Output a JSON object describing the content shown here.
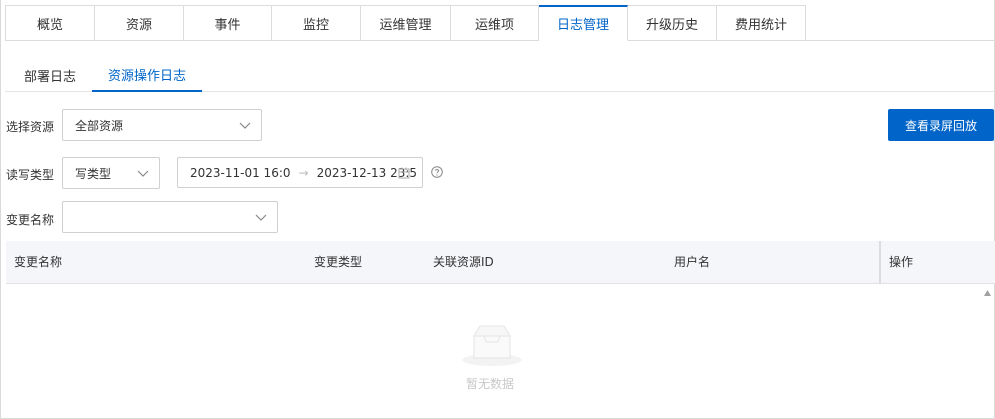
{
  "top_tabs": [
    "概览",
    "资源",
    "事件",
    "监控",
    "运维管理",
    "运维项",
    "日志管理",
    "升级历史",
    "费用统计"
  ],
  "top_tab_active": "日志管理",
  "sub_tabs": [
    "部署日志",
    "资源操作日志"
  ],
  "sub_tab_active": "资源操作日志",
  "filters": {
    "resource_label": "选择资源",
    "resource_value": "全部资源",
    "rw_label": "读写类型",
    "rw_value": "写类型",
    "start_time": "2023-11-01 16:0",
    "end_time": "2023-12-13 23:5",
    "change_label": "变更名称",
    "change_value": ""
  },
  "replay_button": "查看录屏回放",
  "table": {
    "columns": [
      "变更名称",
      "变更类型",
      "关联资源ID",
      "用户名",
      "操作"
    ],
    "empty_text": "暂无数据"
  },
  "colors": {
    "primary": "#0064c8",
    "header_bg": "#f5f6fa"
  }
}
